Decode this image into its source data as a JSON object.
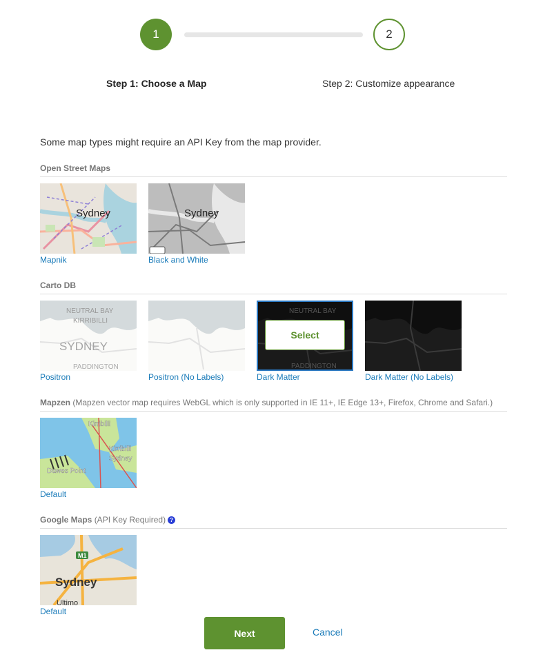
{
  "stepper": {
    "step1": {
      "number": "1",
      "label": "Step 1: Choose a Map"
    },
    "step2": {
      "number": "2",
      "label": "Step 2: Customize appearance"
    }
  },
  "intro": "Some map types might require an API Key from the map provider.",
  "sections": {
    "osm": {
      "title": "Open Street Maps",
      "tiles": [
        {
          "caption": "Mapnik",
          "map_label": "Sydney"
        },
        {
          "caption": "Black and White",
          "map_label": "Sydney"
        }
      ]
    },
    "carto": {
      "title": "Carto DB",
      "tiles": [
        {
          "caption": "Positron",
          "map_label": "SYDNEY",
          "sub_labels": [
            "NEUTRAL BAY",
            "KIRRIBILLI",
            "PADDINGTON"
          ]
        },
        {
          "caption": "Positron (No Labels)"
        },
        {
          "caption": "Dark Matter",
          "sub_labels": [
            "NEUTRAL BAY",
            "PADDINGTON"
          ],
          "button": "Select",
          "selected": true
        },
        {
          "caption": "Dark Matter (No Labels)"
        }
      ]
    },
    "mapzen": {
      "title": "Mapzen",
      "note": "(Mapzen vector map requires WebGL which is only supported in IE 11+, IE Edge 13+, Firefox, Chrome and Safari.)",
      "tiles": [
        {
          "caption": "Default",
          "sub_labels": [
            "Kirribilli",
            "Kirribilli",
            "Sydney",
            "Dawes Point"
          ]
        }
      ]
    },
    "google": {
      "title": "Google Maps",
      "note": "(API Key Required)",
      "help": "?",
      "tiles": [
        {
          "caption": "Default",
          "map_label": "Sydney",
          "sub_labels": [
            "M1",
            "Ultimo"
          ]
        }
      ]
    }
  },
  "actions": {
    "next": "Next",
    "cancel": "Cancel"
  },
  "colors": {
    "primary_green": "#5e9230",
    "link_blue": "#1a7bb9",
    "selected_border": "#2a78c2"
  }
}
